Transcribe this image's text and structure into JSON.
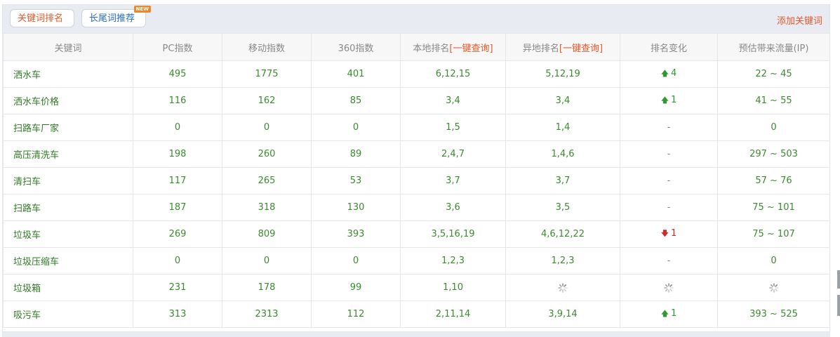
{
  "tabs": [
    {
      "label": "关键词排名",
      "active": true
    },
    {
      "label": "长尾词推荐",
      "badge": "NEW"
    }
  ],
  "add_keyword_label": "添加关键词",
  "table": {
    "headers": {
      "keyword": "关键词",
      "pc_index": "PC指数",
      "mobile_index": "移动指数",
      "index_360": "360指数",
      "local_rank": "本地排名",
      "remote_rank": "异地排名",
      "query_link": "[一键查询]",
      "rank_change": "排名变化",
      "traffic": "预估带来流量(IP)"
    },
    "rows": [
      {
        "keyword": "洒水车",
        "pc": "495",
        "mobile": "1775",
        "i360": "401",
        "local": "6,12,15",
        "remote": "5,12,19",
        "change": "4",
        "change_dir": "up",
        "traffic": "22 ~ 45"
      },
      {
        "keyword": "洒水车价格",
        "pc": "116",
        "mobile": "162",
        "i360": "85",
        "local": "3,4",
        "remote": "3,4",
        "change": "1",
        "change_dir": "up",
        "traffic": "41 ~ 55"
      },
      {
        "keyword": "扫路车厂家",
        "pc": "0",
        "mobile": "0",
        "i360": "0",
        "local": "1,5",
        "remote": "1,4",
        "change": "-",
        "change_dir": "none",
        "traffic": "0"
      },
      {
        "keyword": "高压清洗车",
        "pc": "198",
        "mobile": "260",
        "i360": "89",
        "local": "2,4,7",
        "remote": "1,4,6",
        "change": "-",
        "change_dir": "none",
        "traffic": "297 ~ 503"
      },
      {
        "keyword": "清扫车",
        "pc": "117",
        "mobile": "265",
        "i360": "53",
        "local": "3,7",
        "remote": "3,7",
        "change": "-",
        "change_dir": "none",
        "traffic": "57 ~ 76"
      },
      {
        "keyword": "扫路车",
        "pc": "187",
        "mobile": "318",
        "i360": "130",
        "local": "3,6",
        "remote": "3,5",
        "change": "-",
        "change_dir": "none",
        "traffic": "75 ~ 101"
      },
      {
        "keyword": "垃圾车",
        "pc": "269",
        "mobile": "809",
        "i360": "393",
        "local": "3,5,16,19",
        "remote": "4,6,12,22",
        "change": "1",
        "change_dir": "down",
        "traffic": "75 ~ 107"
      },
      {
        "keyword": "垃圾压缩车",
        "pc": "0",
        "mobile": "0",
        "i360": "0",
        "local": "1,2,3",
        "remote": "1,2,3",
        "change": "-",
        "change_dir": "none",
        "traffic": "0"
      },
      {
        "keyword": "垃圾箱",
        "pc": "231",
        "mobile": "178",
        "i360": "99",
        "local": "1,10",
        "remote": "",
        "change": "",
        "change_dir": "loading",
        "traffic": "",
        "loading": true
      },
      {
        "keyword": "吸污车",
        "pc": "313",
        "mobile": "2313",
        "i360": "112",
        "local": "2,11,14",
        "remote": "3,9,14",
        "change": "1",
        "change_dir": "up",
        "traffic": "393 ~ 525"
      }
    ]
  },
  "colors": {
    "accent": "#e8572a",
    "value_green": "#3a8a2e",
    "up_green": "#2e9a2e",
    "down_red": "#d02a2a"
  },
  "icons": {
    "up": "arrow-up-icon",
    "down": "arrow-down-icon",
    "loading": "loading-spinner-icon"
  }
}
